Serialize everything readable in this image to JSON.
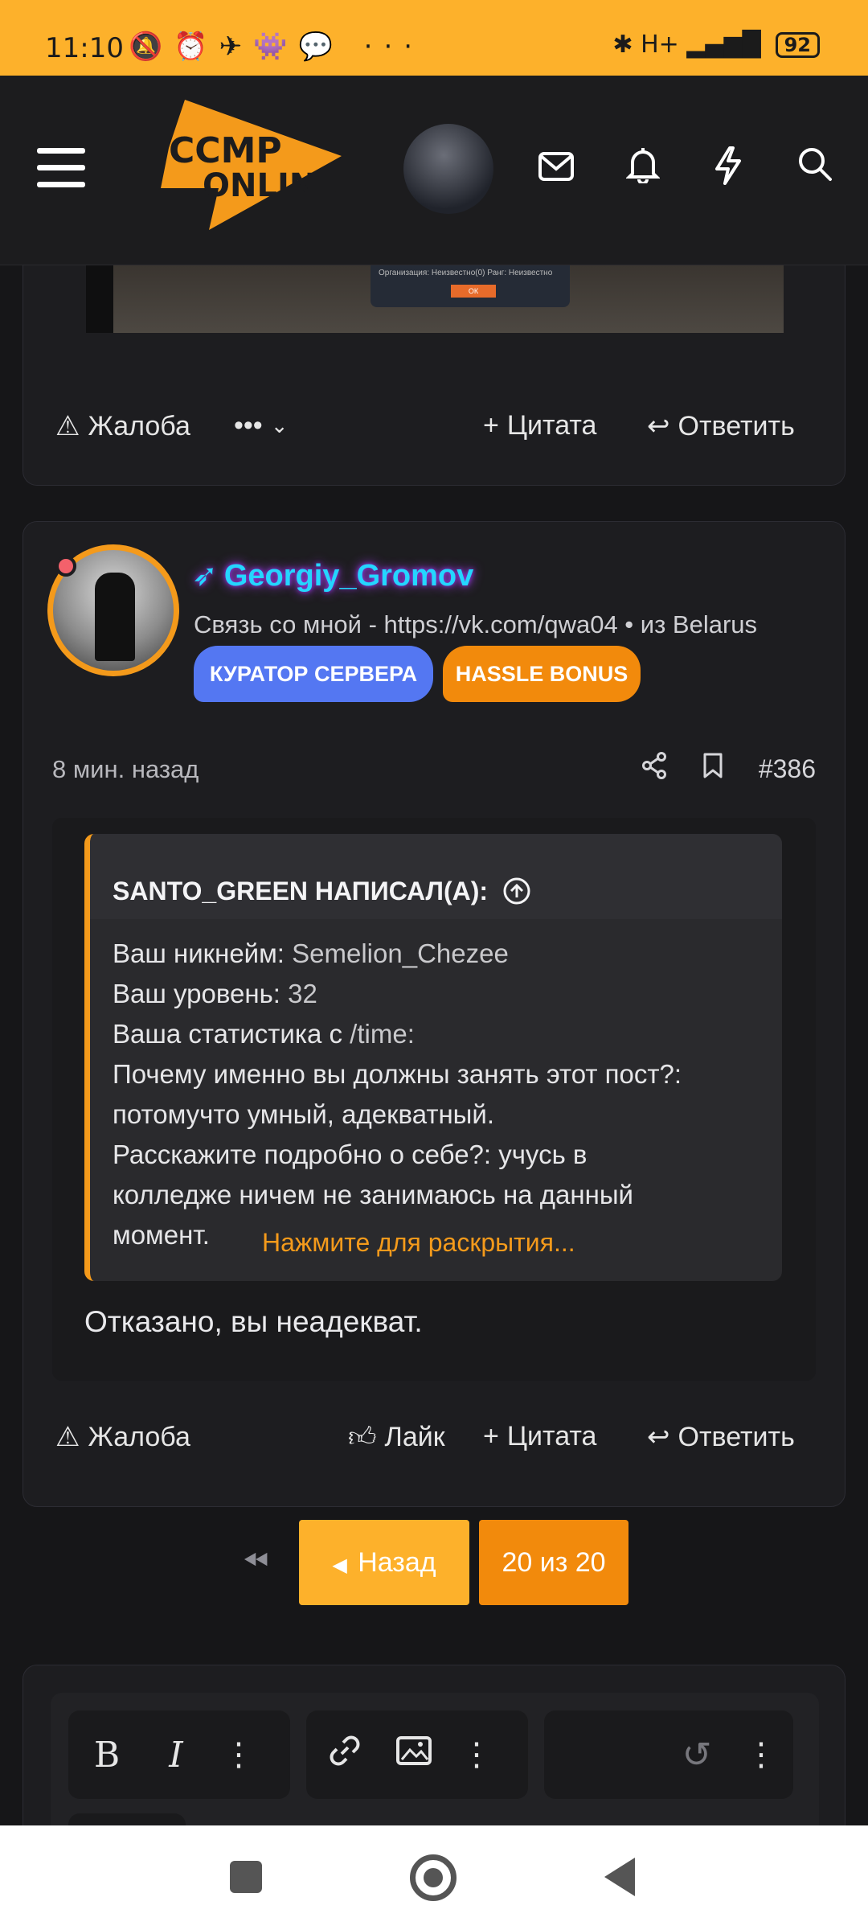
{
  "status_bar": {
    "time": "11:10",
    "left_icons": "🔕⏰✈👾💬 ···",
    "right_icons": "✱ H+ ▂▄▆█",
    "battery": "92"
  },
  "header": {
    "logo_line1": "CCMP",
    "logo_line2": "ONLINE"
  },
  "post_prev": {
    "screenshot_text": "Организация: Неизвестно(0)\nРанг: Неизвестно",
    "screenshot_ok": "ОК",
    "report": "Жалоба",
    "more": "•••",
    "quote": "Цитата",
    "reply": "Ответить"
  },
  "post": {
    "username": "Georgiy_Gromov",
    "user_title": "Связь со мной - https://vk.com/qwa04 • из Belarus",
    "badges": [
      "КУРАТОР СЕРВЕРА",
      "HASSLE BONUS"
    ],
    "time": "8 мин. назад",
    "post_number": "#386",
    "quote_header": "SANTO_GREEN НАПИСАЛ(А):",
    "quote_lines": [
      {
        "label": "Ваш никнейм:",
        "value": " Semelion_Chezee"
      },
      {
        "label": "Ваш уровень:",
        "value": " 32"
      },
      {
        "label": "Ваша статистика с",
        "value": " /time:"
      },
      {
        "label": "Почему именно вы должны занять этот пост?:",
        "value": ""
      },
      {
        "label": "потомучто умный, адекватный.",
        "value": ""
      },
      {
        "label": "Расскажите подробно о себе?: учусь в",
        "value": ""
      },
      {
        "label": "колледже ничем не занимаюсь на данный",
        "value": ""
      },
      {
        "label": "момент.",
        "value": ""
      }
    ],
    "expand_link": "Нажмите для раскрытия...",
    "reply_text": "Отказано, вы неадекват.",
    "report": "Жалоба",
    "like": "Лайк",
    "quote": "Цитата",
    "reply": "Ответить"
  },
  "pagination": {
    "prev": "Назад",
    "pages": "20 из 20"
  },
  "editor": {
    "bold": "B",
    "italic": "I"
  },
  "colors": {
    "accent": "#fdb12b",
    "accent_dark": "#f28a0c",
    "badge_blue": "#5477f2",
    "username": "#24d6ff"
  }
}
